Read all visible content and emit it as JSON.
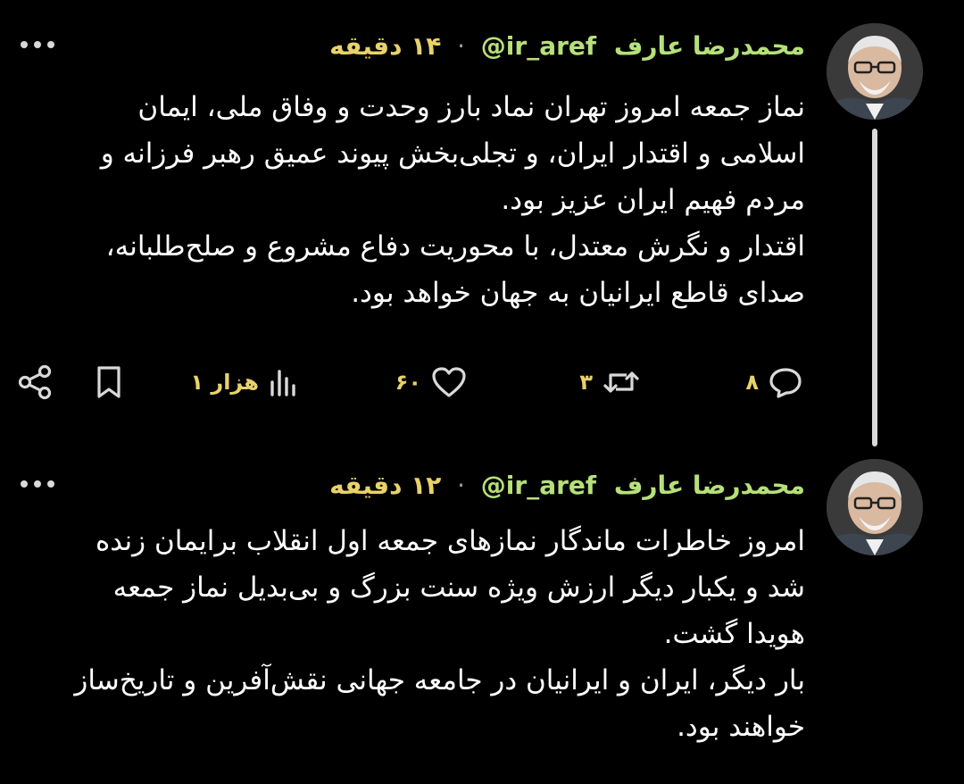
{
  "tweets": [
    {
      "author_name": "محمدرضا عارف",
      "handle": "@ir_aref",
      "separator": "·",
      "time": "۱۴ دقیقه",
      "paragraphs": [
        "نماز جمعه امروز تهران نماد بارز وحدت و وفاق ملی، ایمان اسلامی و اقتدار ایران، و تجلی‌بخش پیوند عمیق رهبر فرزانه و مردم فهیم ایران عزیز بود.",
        "اقتدار و نگرش معتدل، با محوریت دفاع مشروع و صلح‌طلبانه، صدای قاطع ایرانیان به جهان خواهد بود."
      ],
      "actions": {
        "reply_count": "۸",
        "retweet_count": "۳",
        "like_count": "۶۰",
        "views_count": "۱ هزار"
      }
    },
    {
      "author_name": "محمدرضا عارف",
      "handle": "@ir_aref",
      "separator": "·",
      "time": "۱۲ دقیقه",
      "paragraphs": [
        "امروز خاطرات ماندگار نمازهای جمعه اول انقلاب برایمان زنده شد و یکبار دیگر ارزش ویژه سنت بزرگ و بی‌بدیل نماز جمعه هویدا گشت.",
        "بار دیگر، ایران و ایرانیان در جامعه جهانی نقش‌آفرین و تاریخ‌ساز خواهند بود."
      ]
    }
  ],
  "icons": {
    "more": "more-horizontal-icon",
    "reply": "reply-bubble-icon",
    "retweet": "retweet-arrows-icon",
    "like": "heart-icon",
    "views": "views-bar-chart-icon",
    "bookmark": "bookmark-icon",
    "share": "share-icon"
  },
  "colors": {
    "background": "#000000",
    "author": "#b6e07a",
    "time_and_counts": "#e8d26a",
    "text": "#ffffff",
    "icons": "#d9d9d9"
  }
}
